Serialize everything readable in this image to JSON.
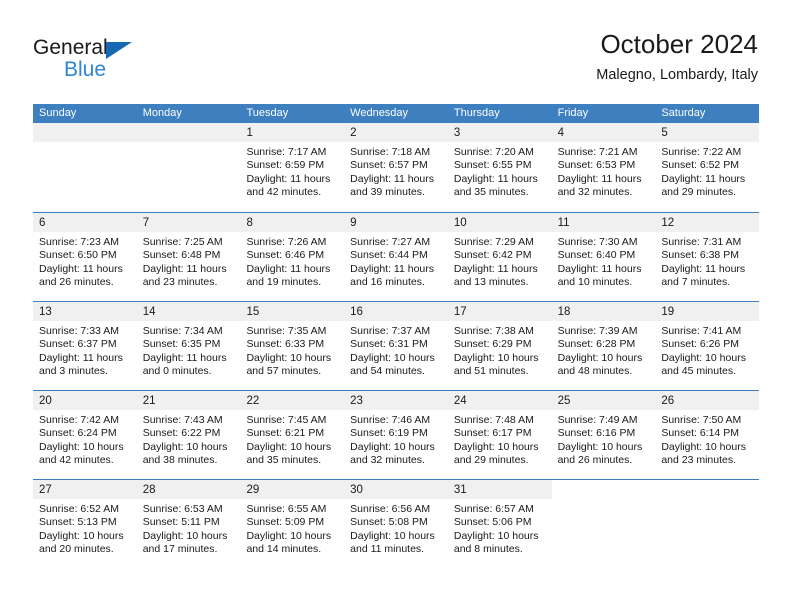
{
  "brand": {
    "word_one": "General",
    "word_two": "Blue",
    "triangle_icon": "brand-triangle-icon",
    "accent_color": "#1668b3",
    "blue_text_color": "#2e86d4"
  },
  "header": {
    "title": "October 2024",
    "subtitle": "Malegno, Lombardy, Italy"
  },
  "calendar": {
    "header_bg": "#3d7fbf",
    "day_band_bg": "#f0f0f0",
    "weekdays": [
      "Sunday",
      "Monday",
      "Tuesday",
      "Wednesday",
      "Thursday",
      "Friday",
      "Saturday"
    ],
    "weeks": [
      [
        {
          "day": "",
          "lines": [],
          "empty": true
        },
        {
          "day": "",
          "lines": [],
          "empty": true
        },
        {
          "day": "1",
          "lines": [
            "Sunrise: 7:17 AM",
            "Sunset: 6:59 PM",
            "Daylight: 11 hours",
            "and 42 minutes."
          ]
        },
        {
          "day": "2",
          "lines": [
            "Sunrise: 7:18 AM",
            "Sunset: 6:57 PM",
            "Daylight: 11 hours",
            "and 39 minutes."
          ]
        },
        {
          "day": "3",
          "lines": [
            "Sunrise: 7:20 AM",
            "Sunset: 6:55 PM",
            "Daylight: 11 hours",
            "and 35 minutes."
          ]
        },
        {
          "day": "4",
          "lines": [
            "Sunrise: 7:21 AM",
            "Sunset: 6:53 PM",
            "Daylight: 11 hours",
            "and 32 minutes."
          ]
        },
        {
          "day": "5",
          "lines": [
            "Sunrise: 7:22 AM",
            "Sunset: 6:52 PM",
            "Daylight: 11 hours",
            "and 29 minutes."
          ]
        }
      ],
      [
        {
          "day": "6",
          "lines": [
            "Sunrise: 7:23 AM",
            "Sunset: 6:50 PM",
            "Daylight: 11 hours",
            "and 26 minutes."
          ]
        },
        {
          "day": "7",
          "lines": [
            "Sunrise: 7:25 AM",
            "Sunset: 6:48 PM",
            "Daylight: 11 hours",
            "and 23 minutes."
          ]
        },
        {
          "day": "8",
          "lines": [
            "Sunrise: 7:26 AM",
            "Sunset: 6:46 PM",
            "Daylight: 11 hours",
            "and 19 minutes."
          ]
        },
        {
          "day": "9",
          "lines": [
            "Sunrise: 7:27 AM",
            "Sunset: 6:44 PM",
            "Daylight: 11 hours",
            "and 16 minutes."
          ]
        },
        {
          "day": "10",
          "lines": [
            "Sunrise: 7:29 AM",
            "Sunset: 6:42 PM",
            "Daylight: 11 hours",
            "and 13 minutes."
          ]
        },
        {
          "day": "11",
          "lines": [
            "Sunrise: 7:30 AM",
            "Sunset: 6:40 PM",
            "Daylight: 11 hours",
            "and 10 minutes."
          ]
        },
        {
          "day": "12",
          "lines": [
            "Sunrise: 7:31 AM",
            "Sunset: 6:38 PM",
            "Daylight: 11 hours",
            "and 7 minutes."
          ]
        }
      ],
      [
        {
          "day": "13",
          "lines": [
            "Sunrise: 7:33 AM",
            "Sunset: 6:37 PM",
            "Daylight: 11 hours",
            "and 3 minutes."
          ]
        },
        {
          "day": "14",
          "lines": [
            "Sunrise: 7:34 AM",
            "Sunset: 6:35 PM",
            "Daylight: 11 hours",
            "and 0 minutes."
          ]
        },
        {
          "day": "15",
          "lines": [
            "Sunrise: 7:35 AM",
            "Sunset: 6:33 PM",
            "Daylight: 10 hours",
            "and 57 minutes."
          ]
        },
        {
          "day": "16",
          "lines": [
            "Sunrise: 7:37 AM",
            "Sunset: 6:31 PM",
            "Daylight: 10 hours",
            "and 54 minutes."
          ]
        },
        {
          "day": "17",
          "lines": [
            "Sunrise: 7:38 AM",
            "Sunset: 6:29 PM",
            "Daylight: 10 hours",
            "and 51 minutes."
          ]
        },
        {
          "day": "18",
          "lines": [
            "Sunrise: 7:39 AM",
            "Sunset: 6:28 PM",
            "Daylight: 10 hours",
            "and 48 minutes."
          ]
        },
        {
          "day": "19",
          "lines": [
            "Sunrise: 7:41 AM",
            "Sunset: 6:26 PM",
            "Daylight: 10 hours",
            "and 45 minutes."
          ]
        }
      ],
      [
        {
          "day": "20",
          "lines": [
            "Sunrise: 7:42 AM",
            "Sunset: 6:24 PM",
            "Daylight: 10 hours",
            "and 42 minutes."
          ]
        },
        {
          "day": "21",
          "lines": [
            "Sunrise: 7:43 AM",
            "Sunset: 6:22 PM",
            "Daylight: 10 hours",
            "and 38 minutes."
          ]
        },
        {
          "day": "22",
          "lines": [
            "Sunrise: 7:45 AM",
            "Sunset: 6:21 PM",
            "Daylight: 10 hours",
            "and 35 minutes."
          ]
        },
        {
          "day": "23",
          "lines": [
            "Sunrise: 7:46 AM",
            "Sunset: 6:19 PM",
            "Daylight: 10 hours",
            "and 32 minutes."
          ]
        },
        {
          "day": "24",
          "lines": [
            "Sunrise: 7:48 AM",
            "Sunset: 6:17 PM",
            "Daylight: 10 hours",
            "and 29 minutes."
          ]
        },
        {
          "day": "25",
          "lines": [
            "Sunrise: 7:49 AM",
            "Sunset: 6:16 PM",
            "Daylight: 10 hours",
            "and 26 minutes."
          ]
        },
        {
          "day": "26",
          "lines": [
            "Sunrise: 7:50 AM",
            "Sunset: 6:14 PM",
            "Daylight: 10 hours",
            "and 23 minutes."
          ]
        }
      ],
      [
        {
          "day": "27",
          "lines": [
            "Sunrise: 6:52 AM",
            "Sunset: 5:13 PM",
            "Daylight: 10 hours",
            "and 20 minutes."
          ]
        },
        {
          "day": "28",
          "lines": [
            "Sunrise: 6:53 AM",
            "Sunset: 5:11 PM",
            "Daylight: 10 hours",
            "and 17 minutes."
          ]
        },
        {
          "day": "29",
          "lines": [
            "Sunrise: 6:55 AM",
            "Sunset: 5:09 PM",
            "Daylight: 10 hours",
            "and 14 minutes."
          ]
        },
        {
          "day": "30",
          "lines": [
            "Sunrise: 6:56 AM",
            "Sunset: 5:08 PM",
            "Daylight: 10 hours",
            "and 11 minutes."
          ]
        },
        {
          "day": "31",
          "lines": [
            "Sunrise: 6:57 AM",
            "Sunset: 5:06 PM",
            "Daylight: 10 hours",
            "and 8 minutes."
          ]
        },
        {
          "day": "",
          "lines": [],
          "blank": true
        },
        {
          "day": "",
          "lines": [],
          "blank": true
        }
      ]
    ]
  }
}
